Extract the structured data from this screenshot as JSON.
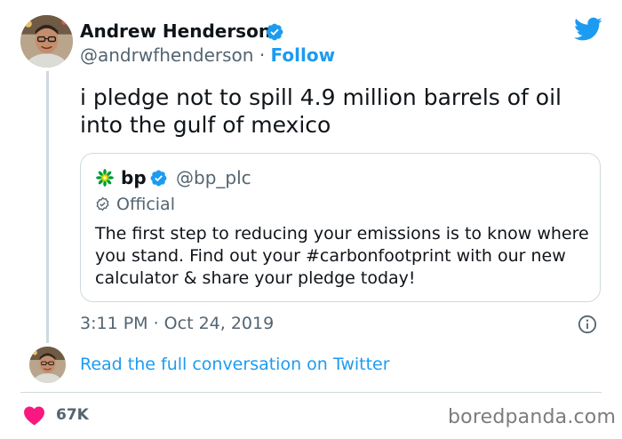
{
  "tweet": {
    "author": {
      "display_name": "Andrew Henderson",
      "handle": "@andrwfhenderson",
      "separator": "·",
      "follow_label": "Follow"
    },
    "text": "i pledge not to spill 4.9 million barrels of oil into the gulf of mexico",
    "timestamp": "3:11 PM · Oct 24, 2019",
    "read_conversation_label": "Read the full conversation on Twitter",
    "likes": "67K"
  },
  "quoted_tweet": {
    "display_name": "bp",
    "handle": "@bp_plc",
    "badge_label": "Official",
    "text": "The first step to reducing your emissions is to know where you stand. Find out your #carbonfootprint with our new calculator & share your pledge today!"
  },
  "watermark": "boredpanda.com",
  "colors": {
    "accent": "#1d9bf0",
    "text_primary": "#0f1419",
    "text_secondary": "#536471",
    "border": "#cfd9de",
    "like": "#f91880"
  },
  "icons": [
    "verified-badge-icon",
    "twitter-bird-icon",
    "bp-helios-logo-icon",
    "official-badge-icon",
    "info-icon",
    "heart-icon"
  ]
}
